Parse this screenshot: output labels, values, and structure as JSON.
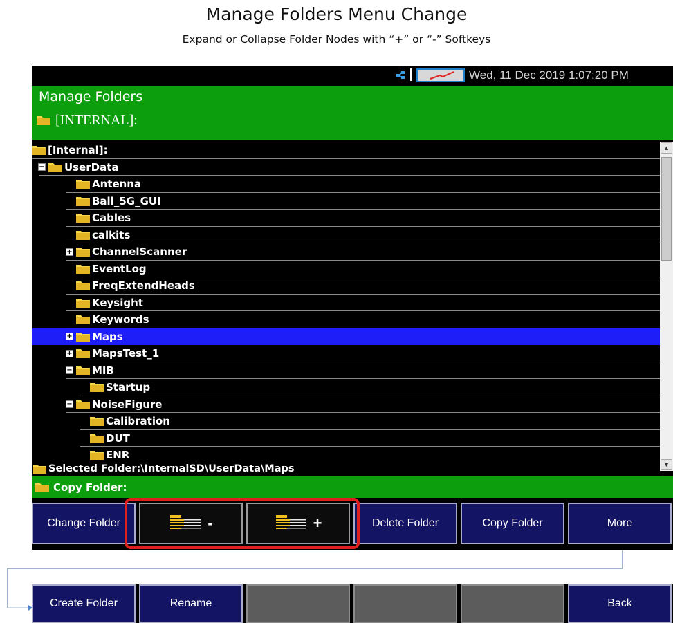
{
  "slide": {
    "title": "Manage Folders Menu Change",
    "subtitle": "Expand or Collapse Folder Nodes with “+” or “-” Softkeys"
  },
  "status_bar": {
    "datetime": "Wed, 11 Dec 2019 1:07:20 PM",
    "icons": [
      "network-icon",
      "battery-icon"
    ]
  },
  "header": {
    "title": "Manage Folders",
    "path": "[INTERNAL]:"
  },
  "tree": {
    "items": [
      {
        "label": "[Internal]:",
        "level": 0,
        "expander": ""
      },
      {
        "label": "UserData",
        "level": 1,
        "expander": "−"
      },
      {
        "label": "Antenna",
        "level": 2,
        "expander": ""
      },
      {
        "label": "Ball_5G_GUI",
        "level": 2,
        "expander": ""
      },
      {
        "label": "Cables",
        "level": 2,
        "expander": ""
      },
      {
        "label": "calkits",
        "level": 2,
        "expander": ""
      },
      {
        "label": "ChannelScanner",
        "level": 2,
        "expander": "+"
      },
      {
        "label": "EventLog",
        "level": 2,
        "expander": ""
      },
      {
        "label": "FreqExtendHeads",
        "level": 2,
        "expander": ""
      },
      {
        "label": "Keysight",
        "level": 2,
        "expander": ""
      },
      {
        "label": "Keywords",
        "level": 2,
        "expander": ""
      },
      {
        "label": "Maps",
        "level": 2,
        "expander": "+",
        "selected": true
      },
      {
        "label": "MapsTest_1",
        "level": 2,
        "expander": "+"
      },
      {
        "label": "MIB",
        "level": 2,
        "expander": "−"
      },
      {
        "label": "Startup",
        "level": 3,
        "expander": ""
      },
      {
        "label": "NoiseFigure",
        "level": 2,
        "expander": "−"
      },
      {
        "label": "Calibration",
        "level": 3,
        "expander": ""
      },
      {
        "label": "DUT",
        "level": 3,
        "expander": ""
      },
      {
        "label": "ENR",
        "level": 3,
        "expander": ""
      }
    ]
  },
  "selected_folder": "Selected Folder:\\InternalSD\\UserData\\Maps",
  "copy_folder": "Copy Folder:",
  "softkeys_row1": [
    {
      "label": "Change Folder",
      "icon": ""
    },
    {
      "label": "-",
      "icon": "collapse-tree-icon"
    },
    {
      "label": "+",
      "icon": "expand-tree-icon"
    },
    {
      "label": "Delete Folder",
      "icon": ""
    },
    {
      "label": "Copy Folder",
      "icon": ""
    },
    {
      "label": "More",
      "icon": ""
    }
  ],
  "softkeys_row2": [
    {
      "label": "Create Folder"
    },
    {
      "label": "Rename"
    },
    {
      "label": ""
    },
    {
      "label": ""
    },
    {
      "label": ""
    },
    {
      "label": "Back"
    }
  ],
  "colors": {
    "header_green": "#0d9e0d",
    "selection_blue": "#1e1ef8",
    "softkey_navy": "#141464",
    "highlight_red": "#e02020",
    "folder_yellow": "#f0c020"
  }
}
